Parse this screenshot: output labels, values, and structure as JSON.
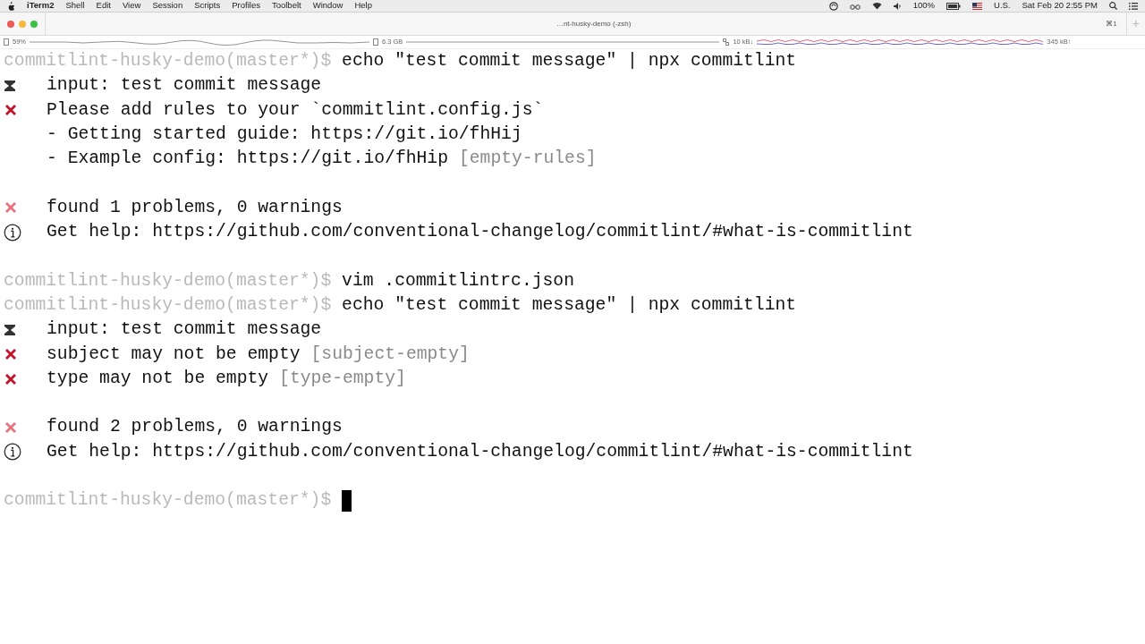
{
  "menu_bar": {
    "app": "iTerm2",
    "items": [
      "Shell",
      "Edit",
      "View",
      "Session",
      "Scripts",
      "Profiles",
      "Toolbelt",
      "Window",
      "Help"
    ],
    "battery": "100%",
    "input_source": "U.S.",
    "clock": "Sat Feb 20  2:55 PM"
  },
  "window": {
    "title": "…nt-husky-demo (-zsh)",
    "shortcut": "⌘1",
    "new_tab": "+"
  },
  "status_bar": {
    "cpu": "59%",
    "memory": "6.3 GB",
    "download": "10 kB↓",
    "upload": "345 kB↑"
  },
  "terminal": {
    "lines": [
      {
        "kind": "prompt",
        "prompt": "commitlint-husky-demo(master*)$",
        "command": "echo \"test commit message\" | npx commitlint"
      },
      {
        "kind": "input",
        "text": "input: test commit message"
      },
      {
        "kind": "error",
        "text": "Please add rules to your `commitlint.config.js`"
      },
      {
        "kind": "detail",
        "text": "- Getting started guide: https://git.io/fhHij"
      },
      {
        "kind": "detail",
        "text": "- Example config: https://git.io/fhHip",
        "rule": "[empty-rules]"
      },
      {
        "kind": "blank"
      },
      {
        "kind": "summary",
        "text": "found 1 problems, 0 warnings"
      },
      {
        "kind": "help",
        "text": "Get help: https://github.com/conventional-changelog/commitlint/#what-is-commitlint"
      },
      {
        "kind": "blank"
      },
      {
        "kind": "prompt",
        "prompt": "commitlint-husky-demo(master*)$",
        "command": "vim .commitlintrc.json"
      },
      {
        "kind": "prompt",
        "prompt": "commitlint-husky-demo(master*)$",
        "command": "echo \"test commit message\" | npx commitlint"
      },
      {
        "kind": "input",
        "text": "input: test commit message"
      },
      {
        "kind": "error",
        "text": "subject may not be empty",
        "rule": "[subject-empty]"
      },
      {
        "kind": "error",
        "text": "type may not be empty",
        "rule": "[type-empty]"
      },
      {
        "kind": "blank"
      },
      {
        "kind": "summary",
        "text": "found 2 problems, 0 warnings"
      },
      {
        "kind": "help",
        "text": "Get help: https://github.com/conventional-changelog/commitlint/#what-is-commitlint"
      },
      {
        "kind": "blank"
      },
      {
        "kind": "prompt",
        "prompt": "commitlint-husky-demo(master*)$",
        "cursor": true
      }
    ]
  }
}
